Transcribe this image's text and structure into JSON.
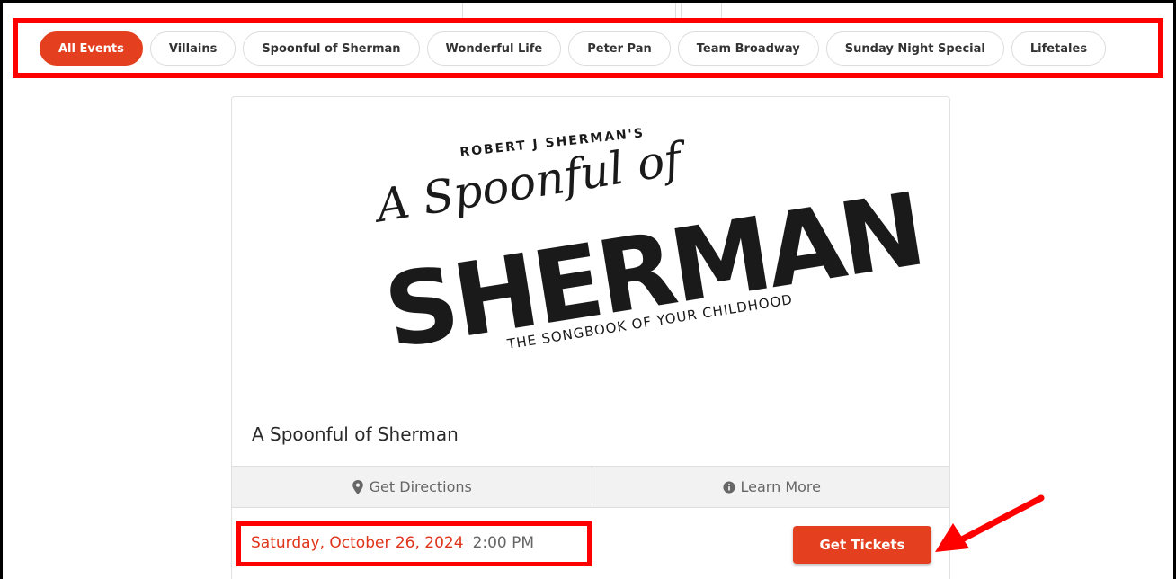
{
  "filters": [
    {
      "label": "All Events",
      "active": true
    },
    {
      "label": "Villains"
    },
    {
      "label": "Spoonful of Sherman"
    },
    {
      "label": "Wonderful Life"
    },
    {
      "label": "Peter Pan"
    },
    {
      "label": "Team Broadway"
    },
    {
      "label": "Sunday Night Special"
    },
    {
      "label": "Lifetales"
    }
  ],
  "event": {
    "poster": {
      "line1": "ROBERT J SHERMAN'S",
      "line2": "A Spoonful of",
      "line3": "SHERMAN",
      "line4": "THE SONGBOOK OF YOUR CHILDHOOD"
    },
    "title": "A Spoonful of Sherman",
    "directions_label": "Get Directions",
    "learn_more_label": "Learn More",
    "date": "Saturday, October 26, 2024",
    "time": "2:00 PM",
    "tickets_label": "Get Tickets"
  },
  "icons": {
    "directions": "map-marker-icon",
    "learn_more": "info-circle-icon"
  },
  "colors": {
    "accent": "#e4401f",
    "date_text": "#e0341a",
    "highlight": "#ff0000"
  }
}
